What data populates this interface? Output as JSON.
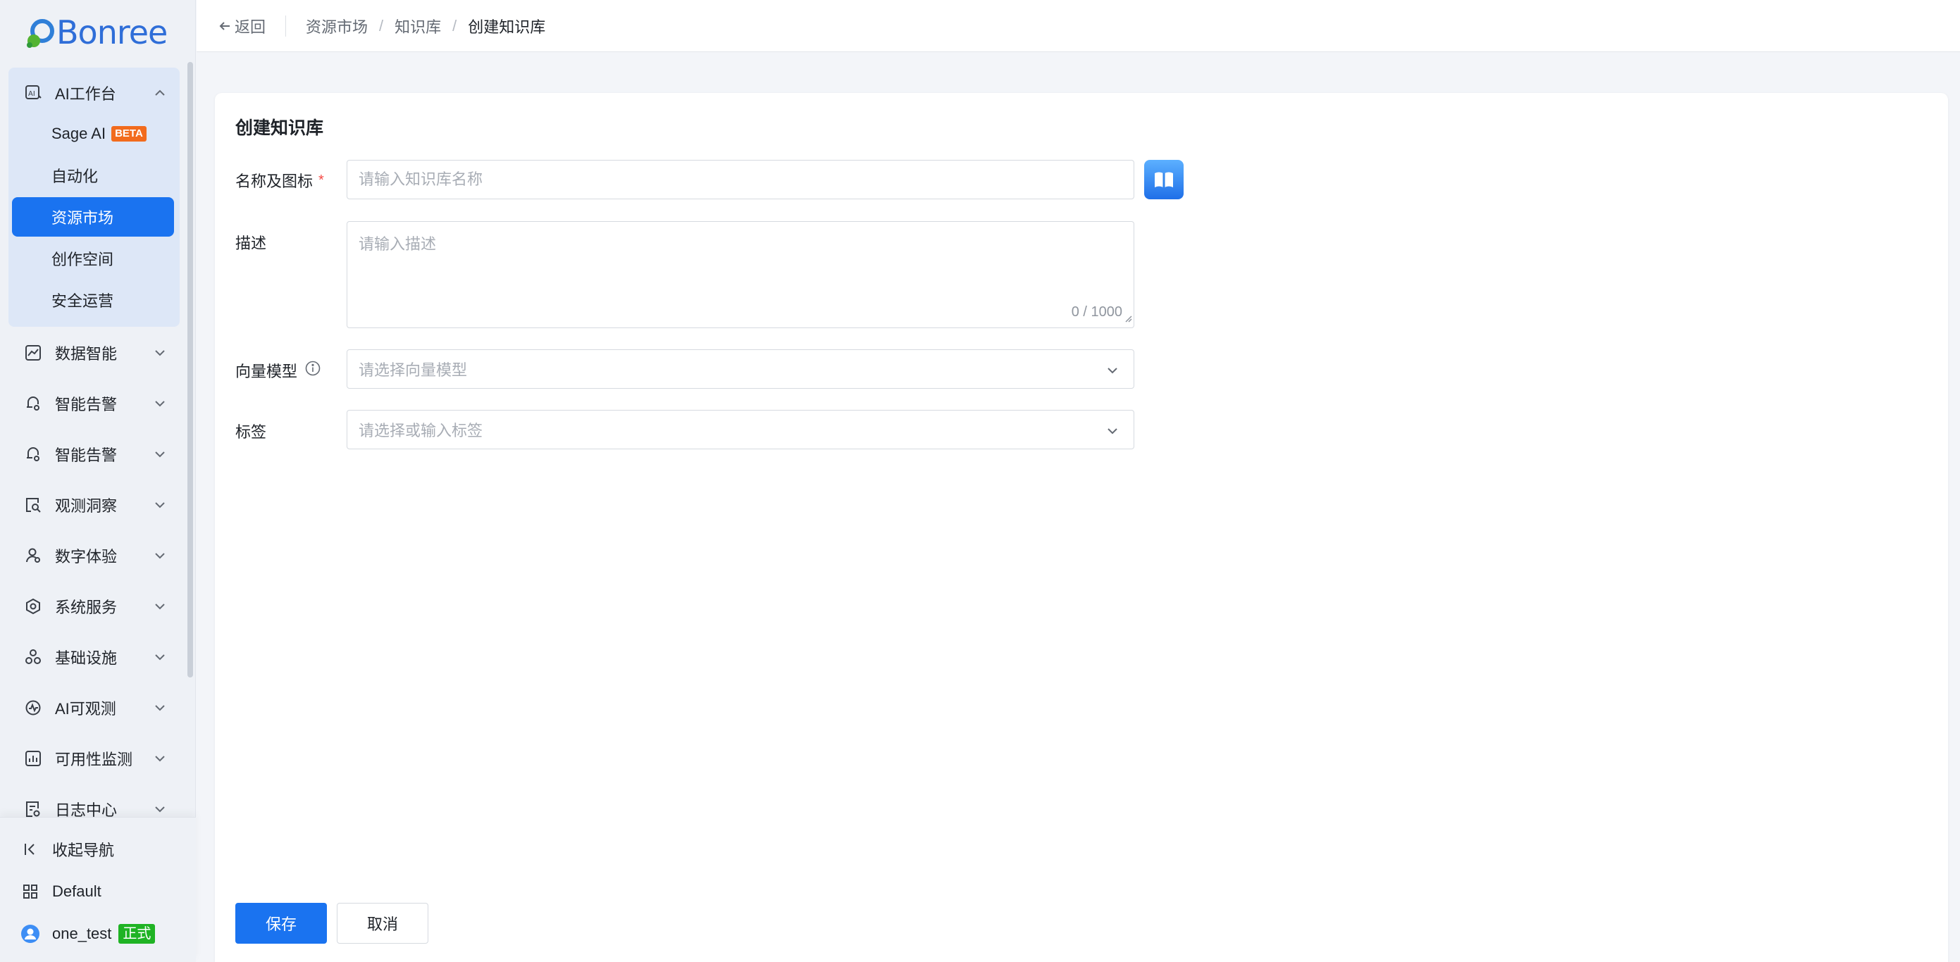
{
  "brand": {
    "name": "Bonree"
  },
  "sidebar": {
    "open_group": {
      "label": "AI工作台",
      "items": [
        {
          "label": "Sage AI",
          "badge": "BETA"
        },
        {
          "label": "自动化"
        },
        {
          "label": "资源市场",
          "active": true
        },
        {
          "label": "创作空间"
        },
        {
          "label": "安全运营"
        }
      ]
    },
    "groups": [
      {
        "label": "数据智能",
        "icon": "chart-line-icon"
      },
      {
        "label": "智能告警",
        "icon": "alert-bell-icon"
      },
      {
        "label": "智能告警",
        "icon": "alert-bell-icon"
      },
      {
        "label": "观测洞察",
        "icon": "search-doc-icon"
      },
      {
        "label": "数字体验",
        "icon": "user-experience-icon"
      },
      {
        "label": "系统服务",
        "icon": "system-service-icon"
      },
      {
        "label": "基础设施",
        "icon": "infrastructure-icon"
      },
      {
        "label": "AI可观测",
        "icon": "ai-observe-icon"
      },
      {
        "label": "可用性监测",
        "icon": "availability-icon"
      },
      {
        "label": "日志中心",
        "icon": "log-icon"
      }
    ],
    "bottom": {
      "collapse_label": "收起导航",
      "workspace_label": "Default",
      "user_name": "one_test",
      "env_badge": "正式"
    }
  },
  "topbar": {
    "back_label": "返回",
    "breadcrumbs": [
      "资源市场",
      "知识库",
      "创建知识库"
    ]
  },
  "form": {
    "title": "创建知识库",
    "name": {
      "label": "名称及图标",
      "required_mark": "*",
      "placeholder": "请输入知识库名称",
      "value": ""
    },
    "description": {
      "label": "描述",
      "placeholder": "请输入描述",
      "value": "",
      "counter": "0 / 1000"
    },
    "vector_model": {
      "label": "向量模型",
      "placeholder": "请选择向量模型"
    },
    "tags": {
      "label": "标签",
      "placeholder": "请选择或输入标签"
    },
    "save_label": "保存",
    "cancel_label": "取消"
  },
  "colors": {
    "primary": "#1a73f0",
    "beta": "#f26b1d",
    "env": "#1fb324"
  }
}
